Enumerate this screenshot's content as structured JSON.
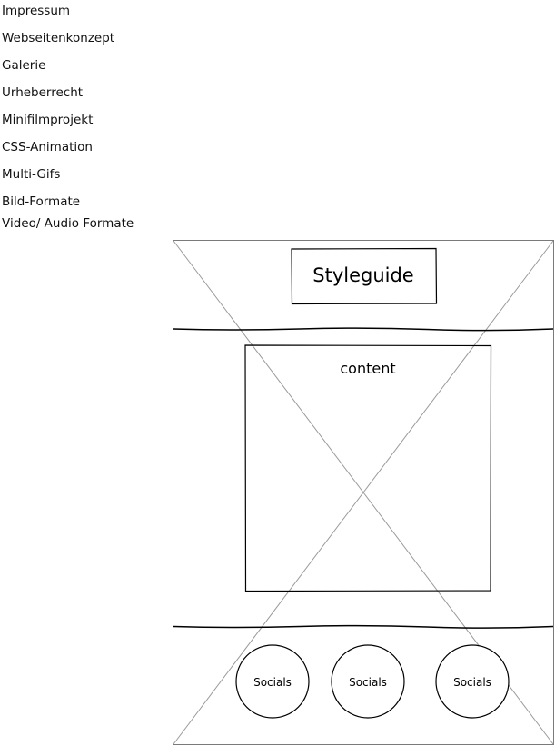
{
  "nav": {
    "items": [
      {
        "label": "Impressum"
      },
      {
        "label": "Webseitenkonzept"
      },
      {
        "label": "Galerie"
      },
      {
        "label": "Urheberrecht"
      },
      {
        "label": "Minifilmprojekt"
      },
      {
        "label": "CSS-Animation"
      },
      {
        "label": "Multi-Gifs"
      },
      {
        "label": "Bild-Formate"
      },
      {
        "label": "Video/ Audio Formate"
      }
    ]
  },
  "wireframe": {
    "title": "Styleguide",
    "content_label": "content",
    "socials": [
      {
        "label": "Socials"
      },
      {
        "label": "Socials"
      },
      {
        "label": "Socials"
      }
    ]
  }
}
